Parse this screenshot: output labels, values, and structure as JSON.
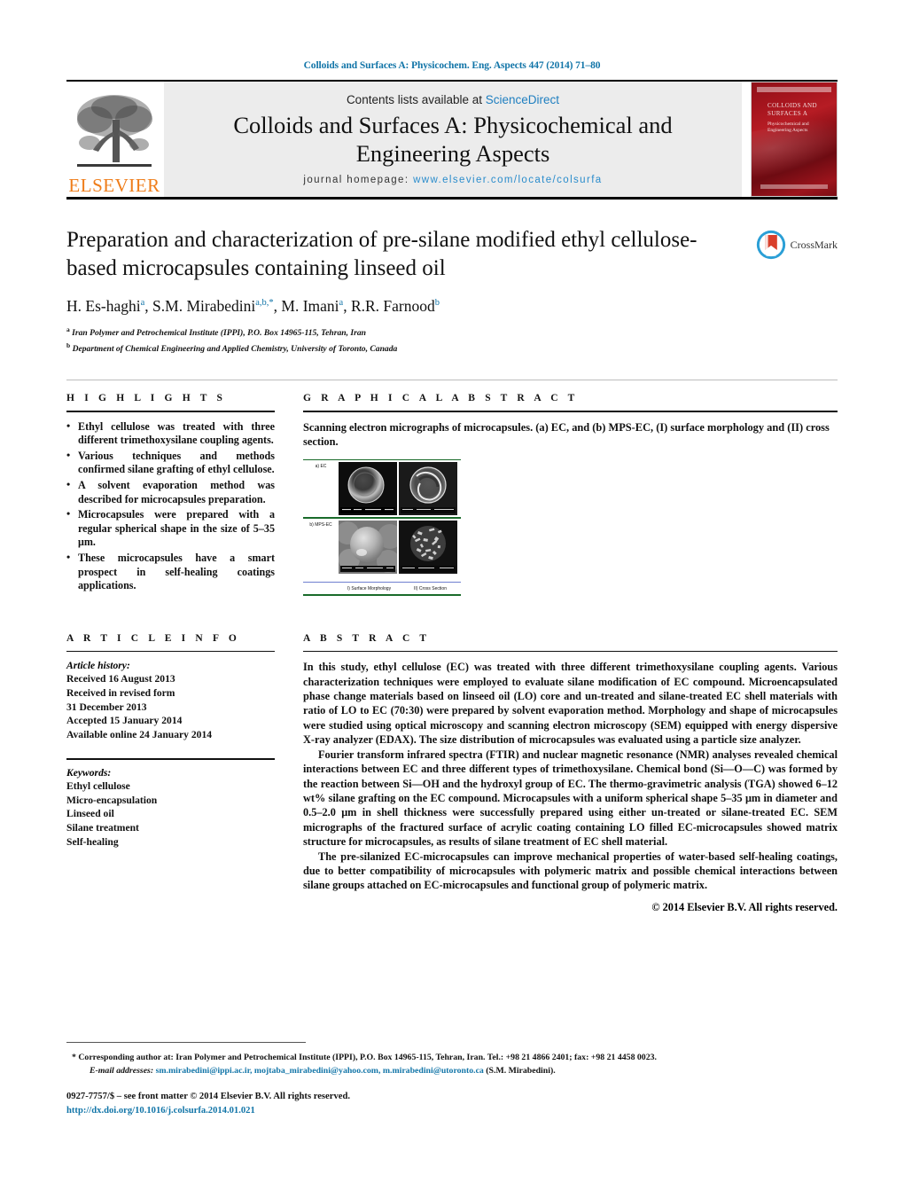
{
  "running_head": "Colloids and Surfaces A: Physicochem. Eng. Aspects 447 (2014) 71–80",
  "masthead": {
    "publisher_word": "ELSEVIER",
    "contents_prefix": "Contents lists available at ",
    "contents_link": "ScienceDirect",
    "journal_title_line1": "Colloids and Surfaces A: Physicochemical and",
    "journal_title_line2": "Engineering Aspects",
    "homepage_prefix": "journal homepage:",
    "homepage_url": "www.elsevier.com/locate/colsurfa",
    "cover_title": "COLLOIDS AND SURFACES A",
    "cover_subtitle": "Physicochemical and Engineering Aspects"
  },
  "article": {
    "title": "Preparation and characterization of pre-silane modified ethyl cellulose-based microcapsules containing linseed oil",
    "crossmark_label": "CrossMark",
    "authors_html": "H. Es-haghi<sup>a</sup>, S.M. Mirabedini<sup>a,b,</sup><sup>*</sup>, M. Imani<sup>a</sup>, R.R. Farnood<sup>b</sup>",
    "affiliation_a": "Iran Polymer and Petrochemical Institute (IPPI), P.O. Box 14965-115, Tehran, Iran",
    "affiliation_b": "Department of Chemical Engineering and Applied Chemistry, University of Toronto, Canada"
  },
  "sections": {
    "highlights_label": "H I G H L I G H T S",
    "graphical_abstract_label": "G R A P H I C A L   A B S T R A C T",
    "article_info_label": "A R T I C L E   I N F O",
    "abstract_label": "A B S T R A C T"
  },
  "highlights": [
    "Ethyl cellulose was treated with three different trimethoxysilane coupling agents.",
    "Various techniques and methods confirmed silane grafting of ethyl cellulose.",
    "A solvent evaporation method was described for microcapsules preparation.",
    "Microcapsules were prepared with a regular spherical shape in the size of 5–35 μm.",
    "These microcapsules have a smart prospect in self-healing coatings applications."
  ],
  "graphical_abstract": {
    "caption": "Scanning electron micrographs of microcapsules. (a) EC, and (b) MPS-EC, (I) surface morphology and (II) cross section.",
    "row_labels": [
      "a) EC",
      "b) MPS-EC"
    ],
    "column_labels": [
      "I) Surface Morphology",
      "II) Cross Section"
    ]
  },
  "article_info": {
    "history_label": "Article history:",
    "history_lines": [
      "Received 16 August 2013",
      "Received in revised form",
      "31 December 2013",
      "Accepted 15 January 2014",
      "Available online 24 January 2014"
    ],
    "keywords_label": "Keywords:",
    "keywords": [
      "Ethyl cellulose",
      "Micro-encapsulation",
      "Linseed oil",
      "Silane treatment",
      "Self-healing"
    ]
  },
  "abstract": {
    "p1": "In this study, ethyl cellulose (EC) was treated with three different trimethoxysilane coupling agents. Various characterization techniques were employed to evaluate silane modification of EC compound. Microencapsulated phase change materials based on linseed oil (LO) core and un-treated and silane-treated EC shell materials with ratio of LO to EC (70:30) were prepared by solvent evaporation method. Morphology and shape of microcapsules were studied using optical microscopy and scanning electron microscopy (SEM) equipped with energy dispersive X-ray analyzer (EDAX). The size distribution of microcapsules was evaluated using a particle size analyzer.",
    "p2": "Fourier transform infrared spectra (FTIR) and nuclear magnetic resonance (NMR) analyses revealed chemical interactions between EC and three different types of trimethoxysilane. Chemical bond (Si—O—C) was formed by the reaction between Si—OH and the hydroxyl group of EC. The thermo-gravimetric analysis (TGA) showed 6–12 wt% silane grafting on the EC compound. Microcapsules with a uniform spherical shape 5–35 μm in diameter and 0.5–2.0 μm in shell thickness were successfully prepared using either un-treated or silane-treated EC. SEM micrographs of the fractured surface of acrylic coating containing LO filled EC-microcapsules showed matrix structure for microcapsules, as results of silane treatment of EC shell material.",
    "p3": "The pre-silanized EC-microcapsules can improve mechanical properties of water-based self-healing coatings, due to better compatibility of microcapsules with polymeric matrix and possible chemical interactions between silane groups attached on EC-microcapsules and functional group of polymeric matrix.",
    "copyright": "© 2014 Elsevier B.V. All rights reserved."
  },
  "footer": {
    "corresponding_marker": "*",
    "corresponding_text": "Corresponding author at: Iran Polymer and Petrochemical Institute (IPPI), P.O. Box 14965-115, Tehran, Iran. Tel.: +98 21 4866 2401; fax: +98 21 4458 0023.",
    "email_label": "E-mail addresses:",
    "emails": "sm.mirabedini@ippi.ac.ir, mojtaba_mirabedini@yahoo.com, m.mirabedini@utoronto.ca",
    "email_suffix": "(S.M. Mirabedini).",
    "issn_line": "0927-7757/$ – see front matter © 2014 Elsevier B.V. All rights reserved.",
    "doi": "http://dx.doi.org/10.1016/j.colsurfa.2014.01.021"
  },
  "colors": {
    "link_blue": "#1275a8",
    "sciencedirect_blue": "#1f7fc0",
    "elsevier_orange": "#ef7d1a",
    "ga_green": "#1a6b2a",
    "cover_red": "#a4141d"
  }
}
